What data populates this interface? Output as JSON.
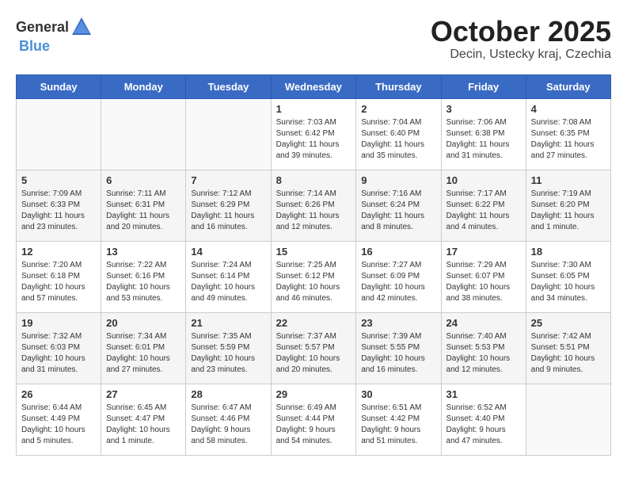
{
  "logo": {
    "general": "General",
    "blue": "Blue"
  },
  "title": "October 2025",
  "subtitle": "Decin, Ustecky kraj, Czechia",
  "days_of_week": [
    "Sunday",
    "Monday",
    "Tuesday",
    "Wednesday",
    "Thursday",
    "Friday",
    "Saturday"
  ],
  "weeks": [
    [
      {
        "day": "",
        "info": ""
      },
      {
        "day": "",
        "info": ""
      },
      {
        "day": "",
        "info": ""
      },
      {
        "day": "1",
        "info": "Sunrise: 7:03 AM\nSunset: 6:42 PM\nDaylight: 11 hours\nand 39 minutes."
      },
      {
        "day": "2",
        "info": "Sunrise: 7:04 AM\nSunset: 6:40 PM\nDaylight: 11 hours\nand 35 minutes."
      },
      {
        "day": "3",
        "info": "Sunrise: 7:06 AM\nSunset: 6:38 PM\nDaylight: 11 hours\nand 31 minutes."
      },
      {
        "day": "4",
        "info": "Sunrise: 7:08 AM\nSunset: 6:35 PM\nDaylight: 11 hours\nand 27 minutes."
      }
    ],
    [
      {
        "day": "5",
        "info": "Sunrise: 7:09 AM\nSunset: 6:33 PM\nDaylight: 11 hours\nand 23 minutes."
      },
      {
        "day": "6",
        "info": "Sunrise: 7:11 AM\nSunset: 6:31 PM\nDaylight: 11 hours\nand 20 minutes."
      },
      {
        "day": "7",
        "info": "Sunrise: 7:12 AM\nSunset: 6:29 PM\nDaylight: 11 hours\nand 16 minutes."
      },
      {
        "day": "8",
        "info": "Sunrise: 7:14 AM\nSunset: 6:26 PM\nDaylight: 11 hours\nand 12 minutes."
      },
      {
        "day": "9",
        "info": "Sunrise: 7:16 AM\nSunset: 6:24 PM\nDaylight: 11 hours\nand 8 minutes."
      },
      {
        "day": "10",
        "info": "Sunrise: 7:17 AM\nSunset: 6:22 PM\nDaylight: 11 hours\nand 4 minutes."
      },
      {
        "day": "11",
        "info": "Sunrise: 7:19 AM\nSunset: 6:20 PM\nDaylight: 11 hours\nand 1 minute."
      }
    ],
    [
      {
        "day": "12",
        "info": "Sunrise: 7:20 AM\nSunset: 6:18 PM\nDaylight: 10 hours\nand 57 minutes."
      },
      {
        "day": "13",
        "info": "Sunrise: 7:22 AM\nSunset: 6:16 PM\nDaylight: 10 hours\nand 53 minutes."
      },
      {
        "day": "14",
        "info": "Sunrise: 7:24 AM\nSunset: 6:14 PM\nDaylight: 10 hours\nand 49 minutes."
      },
      {
        "day": "15",
        "info": "Sunrise: 7:25 AM\nSunset: 6:12 PM\nDaylight: 10 hours\nand 46 minutes."
      },
      {
        "day": "16",
        "info": "Sunrise: 7:27 AM\nSunset: 6:09 PM\nDaylight: 10 hours\nand 42 minutes."
      },
      {
        "day": "17",
        "info": "Sunrise: 7:29 AM\nSunset: 6:07 PM\nDaylight: 10 hours\nand 38 minutes."
      },
      {
        "day": "18",
        "info": "Sunrise: 7:30 AM\nSunset: 6:05 PM\nDaylight: 10 hours\nand 34 minutes."
      }
    ],
    [
      {
        "day": "19",
        "info": "Sunrise: 7:32 AM\nSunset: 6:03 PM\nDaylight: 10 hours\nand 31 minutes."
      },
      {
        "day": "20",
        "info": "Sunrise: 7:34 AM\nSunset: 6:01 PM\nDaylight: 10 hours\nand 27 minutes."
      },
      {
        "day": "21",
        "info": "Sunrise: 7:35 AM\nSunset: 5:59 PM\nDaylight: 10 hours\nand 23 minutes."
      },
      {
        "day": "22",
        "info": "Sunrise: 7:37 AM\nSunset: 5:57 PM\nDaylight: 10 hours\nand 20 minutes."
      },
      {
        "day": "23",
        "info": "Sunrise: 7:39 AM\nSunset: 5:55 PM\nDaylight: 10 hours\nand 16 minutes."
      },
      {
        "day": "24",
        "info": "Sunrise: 7:40 AM\nSunset: 5:53 PM\nDaylight: 10 hours\nand 12 minutes."
      },
      {
        "day": "25",
        "info": "Sunrise: 7:42 AM\nSunset: 5:51 PM\nDaylight: 10 hours\nand 9 minutes."
      }
    ],
    [
      {
        "day": "26",
        "info": "Sunrise: 6:44 AM\nSunset: 4:49 PM\nDaylight: 10 hours\nand 5 minutes."
      },
      {
        "day": "27",
        "info": "Sunrise: 6:45 AM\nSunset: 4:47 PM\nDaylight: 10 hours\nand 1 minute."
      },
      {
        "day": "28",
        "info": "Sunrise: 6:47 AM\nSunset: 4:46 PM\nDaylight: 9 hours\nand 58 minutes."
      },
      {
        "day": "29",
        "info": "Sunrise: 6:49 AM\nSunset: 4:44 PM\nDaylight: 9 hours\nand 54 minutes."
      },
      {
        "day": "30",
        "info": "Sunrise: 6:51 AM\nSunset: 4:42 PM\nDaylight: 9 hours\nand 51 minutes."
      },
      {
        "day": "31",
        "info": "Sunrise: 6:52 AM\nSunset: 4:40 PM\nDaylight: 9 hours\nand 47 minutes."
      },
      {
        "day": "",
        "info": ""
      }
    ]
  ]
}
